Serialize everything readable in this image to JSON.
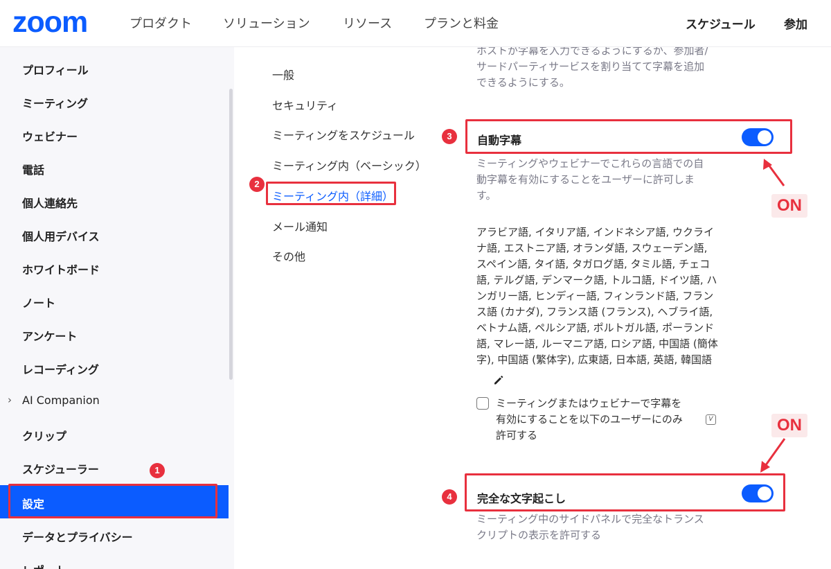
{
  "header": {
    "logo": "zoom",
    "nav": [
      "プロダクト",
      "ソリューション",
      "リソース",
      "プランと料金"
    ],
    "schedule_label": "スケジュール",
    "join_label": "参加"
  },
  "sidebar": {
    "items": [
      {
        "label": "プロフィール"
      },
      {
        "label": "ミーティング"
      },
      {
        "label": "ウェビナー"
      },
      {
        "label": "電話"
      },
      {
        "label": "個人連絡先"
      },
      {
        "label": "個人用デバイス"
      },
      {
        "label": "ホワイトボード"
      },
      {
        "label": "ノート"
      },
      {
        "label": "アンケート"
      },
      {
        "label": "レコーディング"
      },
      {
        "label": "AI Companion"
      },
      {
        "label": "クリップ"
      },
      {
        "label": "スケジューラー"
      },
      {
        "label": "設定"
      },
      {
        "label": "データとプライバシー"
      },
      {
        "label": "レポート"
      }
    ],
    "active": "設定"
  },
  "subnav": {
    "items": [
      "一般",
      "セキュリティ",
      "ミーティングをスケジュール",
      "ミーティング内（ベーシック）",
      "ミーティング内（詳細）",
      "メール通知",
      "その他"
    ],
    "active": "ミーティング内（詳細）"
  },
  "content": {
    "prev_desc_line1": "ホストが字幕を入力できるようにするか、参加者/",
    "prev_desc_line2": "サードパーティサービスを割り当てて字幕を追加",
    "prev_desc_line3": "できるようにする。",
    "auto_caption": {
      "title": "自動字幕",
      "desc_line1": "ミーティングやウェビナーでこれらの言語での自",
      "desc_line2": "動字幕を有効にすることをユーザーに許可しま",
      "desc_line3": "す。",
      "enabled": true
    },
    "languages": [
      "アラビア語, イタリア語, インドネシア語, ウクライ",
      "ナ語, エストニア語, オランダ語, スウェーデン語,",
      "スペイン語, タイ語, タガログ語, タミル語, チェコ",
      "語, テルグ語, デンマーク語, トルコ語, ドイツ語, ハ",
      "ンガリー語, ヒンディー語, フィンランド語, フラン",
      "ス語 (カナダ), フランス語 (フランス), ヘブライ語,",
      "ベトナム語, ペルシア語, ポルトガル語, ポーランド",
      "語, マレー語, ルーマニア語, ロシア語, 中国語 (簡体",
      "字), 中国語 (繁体字), 広東語, 日本語, 英語, 韓国語"
    ],
    "restrict_checkbox": {
      "line1": "ミーティングまたはウェビナーで字幕を",
      "line2": "有効にすることを以下のユーザーにのみ",
      "line3": "許可する",
      "badge": "V",
      "checked": false
    },
    "full_transcript": {
      "title": "完全な文字起こし",
      "desc_line1": "ミーティング中のサイドパネルで完全なトランス",
      "desc_line2": "クリプトの表示を許可する",
      "enabled": true
    }
  },
  "annotations": {
    "badges": [
      "1",
      "2",
      "3",
      "4"
    ],
    "on_label_1": "ON",
    "on_label_2": "ON",
    "color": "#e8303e"
  },
  "colors": {
    "brand": "#0b5cff",
    "annotation": "#e8303e"
  }
}
